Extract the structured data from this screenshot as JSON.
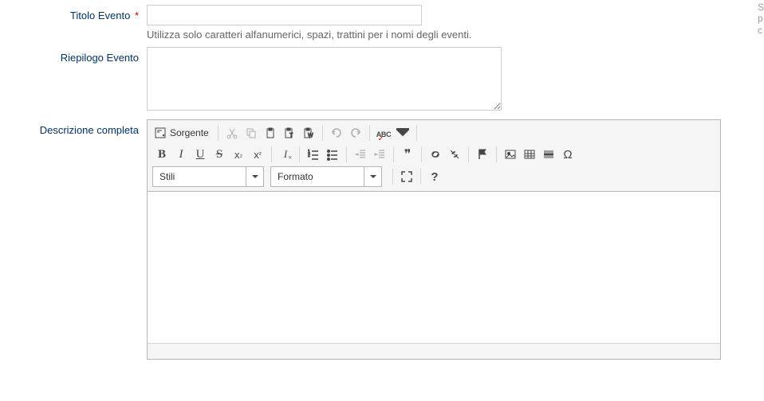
{
  "fields": {
    "titolo": {
      "label": "Titolo Evento",
      "required": "*",
      "help": "Utilizza solo caratteri alfanumerici, spazi, trattini per i nomi degli eventi."
    },
    "riepilogo": {
      "label": "Riepilogo Evento"
    },
    "descrizione": {
      "label": "Descrizione completa"
    }
  },
  "editor": {
    "sorgente": "Sorgente",
    "combos": {
      "stili": "Stili",
      "formato": "Formato"
    },
    "help": "?",
    "quotes": "❞",
    "omega": "Ω"
  },
  "side": {
    "l1": "S",
    "l2": "p",
    "l3": "c"
  }
}
